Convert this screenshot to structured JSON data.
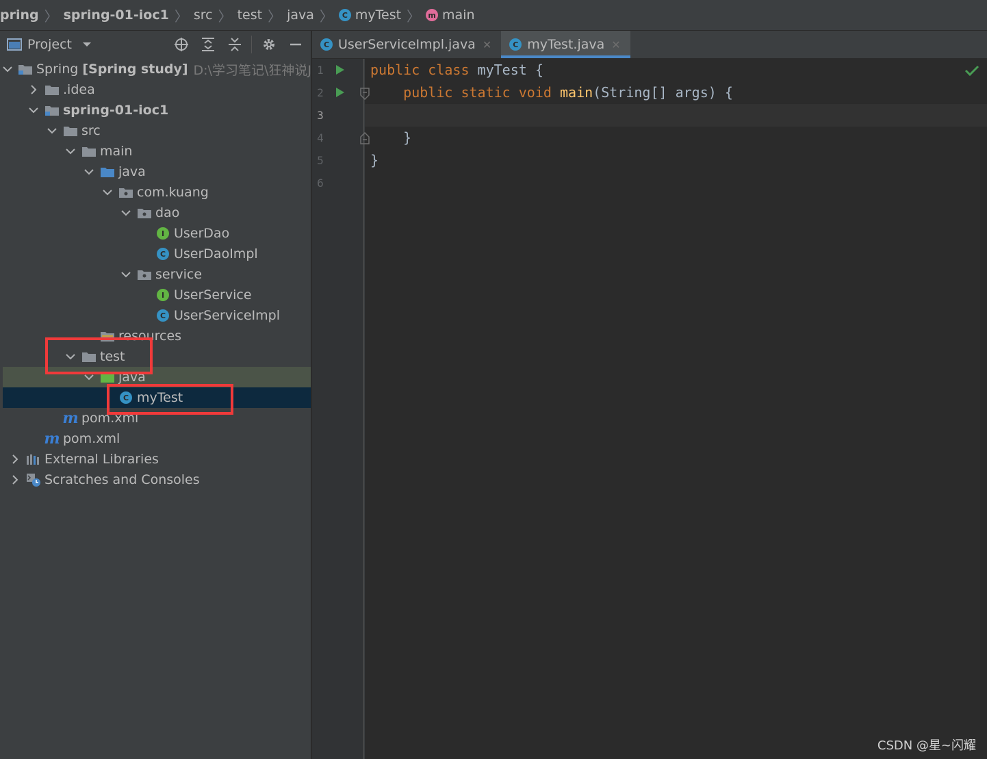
{
  "breadcrumb": {
    "items": [
      "pring",
      "spring-01-ioc1",
      "src",
      "test",
      "java",
      "myTest",
      "main"
    ]
  },
  "project_panel": {
    "title": "Project",
    "tree": [
      {
        "label": "Spring",
        "suffix": "[Spring study]",
        "path": "D:\\学习笔记\\狂神说Jav"
      },
      {
        "label": ".idea"
      },
      {
        "label": "spring-01-ioc1"
      },
      {
        "label": "src"
      },
      {
        "label": "main"
      },
      {
        "label": "java"
      },
      {
        "label": "com.kuang"
      },
      {
        "label": "dao"
      },
      {
        "label": "UserDao",
        "badge": "I"
      },
      {
        "label": "UserDaoImpl",
        "badge": "C"
      },
      {
        "label": "service"
      },
      {
        "label": "UserService",
        "badge": "I"
      },
      {
        "label": "UserServiceImpl",
        "badge": "C"
      },
      {
        "label": "resources"
      },
      {
        "label": "test"
      },
      {
        "label": "java"
      },
      {
        "label": "myTest",
        "badge": "C"
      },
      {
        "label": "pom.xml"
      },
      {
        "label": "pom.xml"
      },
      {
        "label": "External Libraries"
      },
      {
        "label": "Scratches and Consoles"
      }
    ]
  },
  "tabs": [
    {
      "label": "UserServiceImpl.java",
      "badge": "C",
      "active": false
    },
    {
      "label": "myTest.java",
      "badge": "C",
      "active": true
    }
  ],
  "editor": {
    "line_numbers": [
      "1",
      "2",
      "3",
      "4",
      "5",
      "6"
    ],
    "lines": [
      {
        "kw1": "public",
        "kw2": "class",
        "rest": " myTest {"
      },
      {
        "kw1": "public",
        "kw2": "static",
        "kw3": "void",
        "fn": "main",
        "rest": "(String[] args) {"
      },
      {
        "text": ""
      },
      {
        "text": "}"
      },
      {
        "text": "}"
      },
      {
        "text": ""
      }
    ]
  },
  "watermark": "CSDN @星~闪耀",
  "colors": {
    "keyword": "#cc7832",
    "function": "#ffc66d",
    "code_text": "#a9b7c6",
    "highlight_box": "#f03a3a",
    "selection": "#0d293e",
    "tab_underline": "#4a88c7"
  }
}
